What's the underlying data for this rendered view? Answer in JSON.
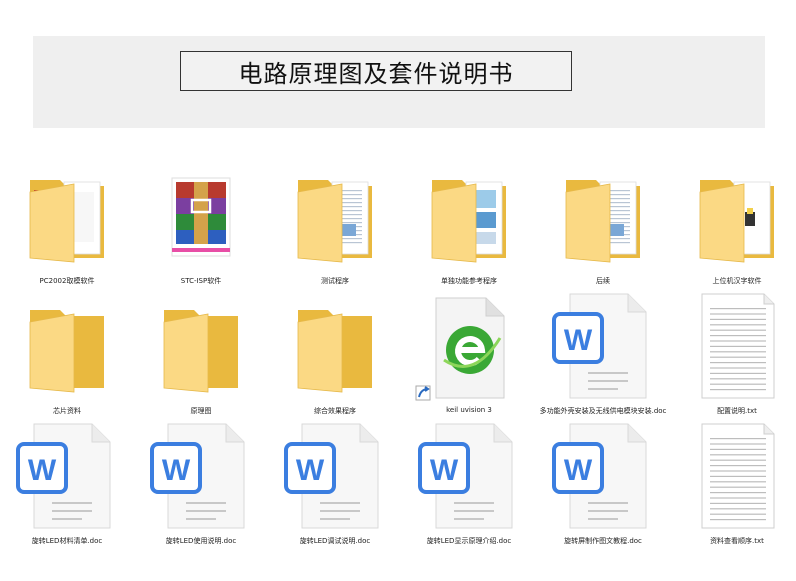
{
  "header": {
    "title": "电路原理图及套件说明书"
  },
  "files": [
    {
      "label": "PC2002取模软件",
      "icon": "folder-winrar-icon"
    },
    {
      "label": "STC-ISP软件",
      "icon": "winrar-archive-icon"
    },
    {
      "label": "测试程序",
      "icon": "folder-document-icon"
    },
    {
      "label": "单独功能参考程序",
      "icon": "folder-image-icon"
    },
    {
      "label": "后续",
      "icon": "folder-document-icon"
    },
    {
      "label": "上位机汉字软件",
      "icon": "folder-app-icon"
    },
    {
      "label": "芯片资料",
      "icon": "folder-icon"
    },
    {
      "label": "原理图",
      "icon": "folder-icon"
    },
    {
      "label": "综合效果程序",
      "icon": "folder-icon"
    },
    {
      "label": "keil uvision 3",
      "icon": "keil-shortcut-icon"
    },
    {
      "label": "多功能外壳安装及无线供电模块安装.doc",
      "icon": "word-doc-icon"
    },
    {
      "label": "配置说明.txt",
      "icon": "text-file-icon"
    },
    {
      "label": "旋转LED材料清单.doc",
      "icon": "word-doc-icon"
    },
    {
      "label": "旋转LED使用说明.doc",
      "icon": "word-doc-icon"
    },
    {
      "label": "旋转LED调试说明.doc",
      "icon": "word-doc-icon"
    },
    {
      "label": "旋转LED显示原理介绍.doc",
      "icon": "word-doc-icon"
    },
    {
      "label": "旋转屏制作图文教程.doc",
      "icon": "word-doc-icon"
    },
    {
      "label": "资料查看顺序.txt",
      "icon": "text-file-icon"
    }
  ],
  "colors": {
    "folder_back": "#f0c14b",
    "folder_front": "#fbdf8f",
    "word_blue": "#3b7ee0"
  }
}
